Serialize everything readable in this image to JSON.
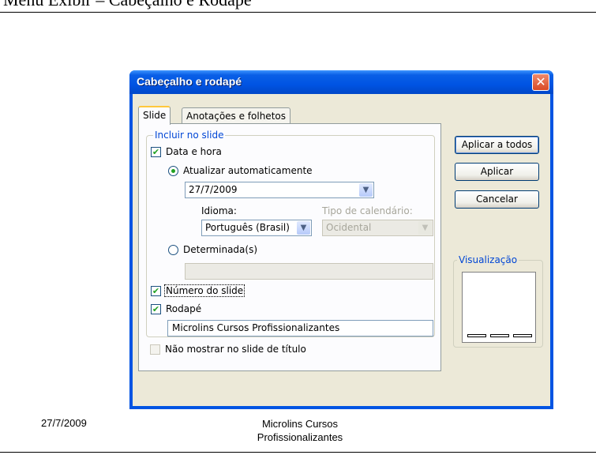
{
  "page": {
    "header_title": "Menu Exibir – Cabeçalho e Rodapé",
    "footer_date": "27/7/2009",
    "footer_text": "Microlins Cursos Profissionalizantes"
  },
  "dialog": {
    "title": "Cabeçalho e rodapé",
    "close_glyph": "✕",
    "tabs": [
      {
        "label": "Slide",
        "active": true
      },
      {
        "label": "Anotações e folhetos",
        "active": false
      }
    ],
    "group_label": "Incluir no slide",
    "date_time": {
      "label": "Data e hora",
      "checked": true
    },
    "auto_update": {
      "label": "Atualizar automaticamente",
      "selected": true
    },
    "date_format_value": "27/7/2009",
    "language": {
      "label": "Idioma:",
      "value": "Português (Brasil)"
    },
    "calendar": {
      "label": "Tipo de calendário:",
      "value": "Ocidental",
      "disabled": true
    },
    "fixed": {
      "label": "Determinada(s)",
      "selected": false,
      "value": ""
    },
    "slide_number": {
      "label": "Número do slide",
      "checked": true
    },
    "footer": {
      "label": "Rodapé",
      "checked": true,
      "value": "Microlins Cursos Profissionalizantes"
    },
    "dont_show_title": {
      "label": "Não mostrar no slide de título",
      "checked": false
    },
    "buttons": {
      "apply_all": "Aplicar a todos",
      "apply": "Aplicar",
      "cancel": "Cancelar"
    },
    "preview_label": "Visualização",
    "check_glyph": "✔",
    "arrow_glyph": "▼"
  },
  "colors": {
    "titlebar": "#0054e3",
    "dialog_face": "#ece9d8",
    "group_label": "#0046d5"
  }
}
